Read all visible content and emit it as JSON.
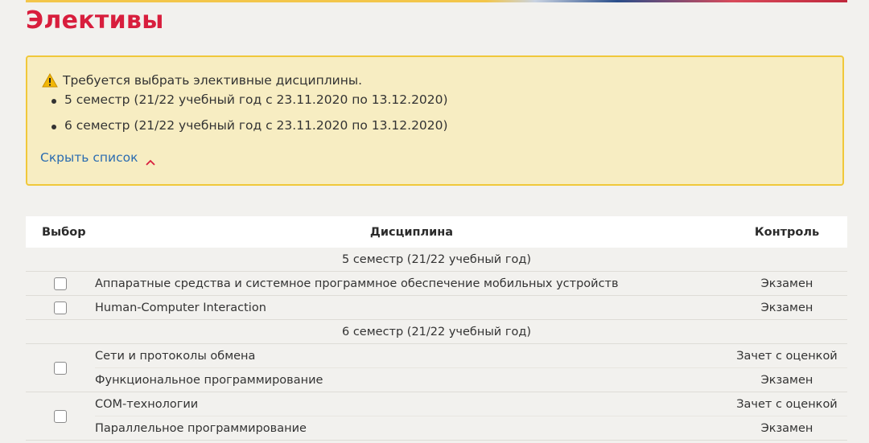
{
  "page": {
    "title": "Элективы"
  },
  "alert": {
    "message": "Требуется выбрать элективные дисциплины.",
    "items": [
      "5 семестр (21/22 учебный год с 23.11.2020 по 13.12.2020)",
      "6 семестр (21/22 учебный год с 23.11.2020 по 13.12.2020)"
    ],
    "toggle_label": "Скрыть список",
    "icon": "warning-icon"
  },
  "table": {
    "headers": {
      "select": "Выбор",
      "discipline": "Дисциплина",
      "control": "Контроль"
    },
    "groups": [
      {
        "label": "5 семестр (21/22 учебный год)",
        "choices": [
          {
            "checked": false,
            "items": [
              {
                "name": "Аппаратные средства и системное программное обеспечение мобильных устройств",
                "control": "Экзамен"
              }
            ]
          },
          {
            "checked": false,
            "items": [
              {
                "name": "Human-Computer Interaction",
                "control": "Экзамен"
              }
            ]
          }
        ]
      },
      {
        "label": "6 семестр (21/22 учебный год)",
        "choices": [
          {
            "checked": false,
            "items": [
              {
                "name": "Сети и протоколы обмена",
                "control": "Зачет с оценкой"
              },
              {
                "name": "Функциональное программирование",
                "control": "Экзамен"
              }
            ]
          },
          {
            "checked": false,
            "items": [
              {
                "name": "COM-технологии",
                "control": "Зачет с оценкой"
              },
              {
                "name": "Параллельное программирование",
                "control": "Экзамен"
              }
            ]
          }
        ]
      }
    ]
  },
  "colors": {
    "accent_red": "#d81e3d",
    "alert_bg": "#f7edc2",
    "alert_border": "#f0c83a",
    "link_blue": "#2b6cb0"
  }
}
